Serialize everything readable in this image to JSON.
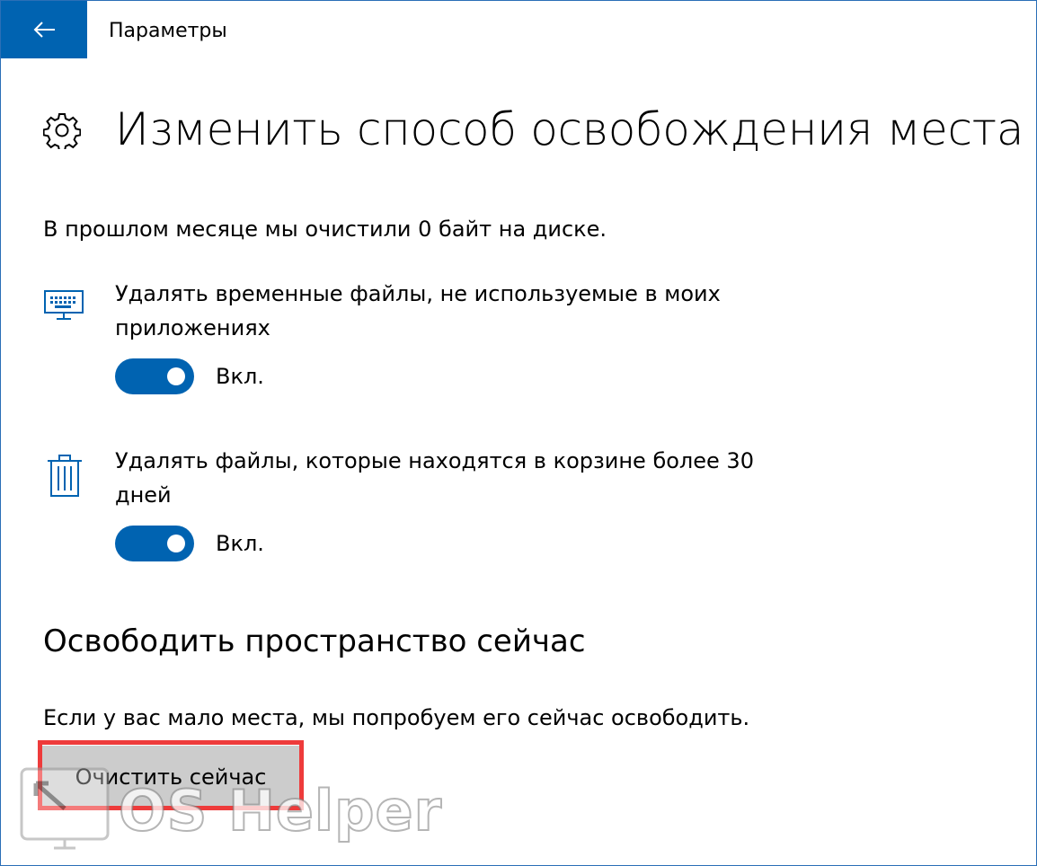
{
  "window": {
    "title": "Параметры"
  },
  "page": {
    "title": "Изменить способ освобождения места",
    "summary": "В прошлом месяце мы очистили 0 байт на диске."
  },
  "options": [
    {
      "icon": "keyboard-monitor-icon",
      "label": "Удалять временные файлы, не используемые в моих приложениях",
      "toggle_on": true,
      "state_label": "Вкл."
    },
    {
      "icon": "trash-icon",
      "label": "Удалять файлы, которые находятся в корзине более 30 дней",
      "toggle_on": true,
      "state_label": "Вкл."
    }
  ],
  "free_now": {
    "heading": "Освободить пространство сейчас",
    "description": "Если у вас мало места, мы попробуем его сейчас освободить.",
    "button_label": "Очистить сейчас"
  },
  "watermark": {
    "text": "OS Helper"
  },
  "colors": {
    "accent": "#0063b1",
    "button_bg": "#cccccc",
    "highlight": "#ee3b3b"
  }
}
